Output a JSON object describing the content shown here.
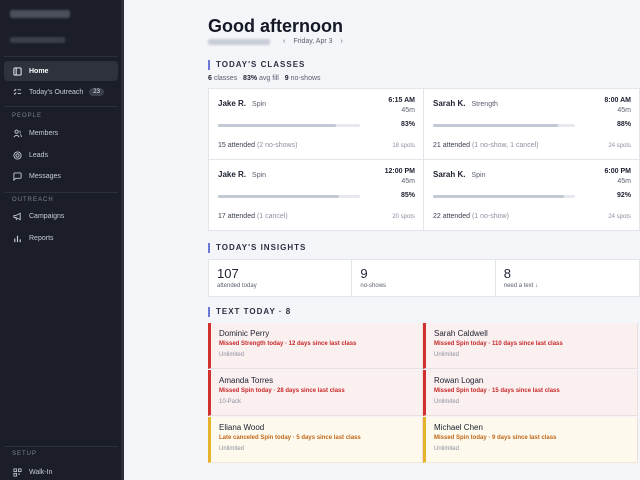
{
  "sidebar": {
    "nav": [
      {
        "label": "Home",
        "icon": "home-icon",
        "active": true
      },
      {
        "label": "Today's Outreach",
        "icon": "checklist-icon",
        "badge": "23"
      }
    ],
    "people_section": "PEOPLE",
    "people": [
      {
        "label": "Members",
        "icon": "users-icon"
      },
      {
        "label": "Leads",
        "icon": "target-icon"
      },
      {
        "label": "Messages",
        "icon": "chat-icon"
      }
    ],
    "outreach_section": "OUTREACH",
    "outreach": [
      {
        "label": "Campaigns",
        "icon": "megaphone-icon"
      },
      {
        "label": "Reports",
        "icon": "bar-chart-icon"
      }
    ],
    "setup_section": "SETUP",
    "setup": [
      {
        "label": "Walk-In",
        "icon": "qr-icon"
      }
    ]
  },
  "header": {
    "greeting": "Good afternoon",
    "date": "Friday, Apr 3",
    "prev": "‹",
    "next": "›"
  },
  "classes": {
    "title": "TODAY'S CLASSES",
    "summary": {
      "count": "6",
      "count_label": "classes",
      "fill": "83%",
      "fill_label": "avg fill",
      "noshows": "9",
      "noshows_label": "no-shows"
    },
    "items": [
      {
        "coach": "Jake R.",
        "type": "Spin",
        "time": "6:15 AM",
        "duration": "45m",
        "fill": 83,
        "pct": "83%",
        "attended": "15 attended",
        "note": "(2 no-shows)",
        "spots": "18 spots"
      },
      {
        "coach": "Sarah K.",
        "type": "Strength",
        "time": "8:00 AM",
        "duration": "45m",
        "fill": 88,
        "pct": "88%",
        "attended": "21 attended",
        "note": "(1 no-show, 1 cancel)",
        "spots": "24 spots"
      },
      {
        "coach": "Jake R.",
        "type": "Spin",
        "time": "12:00 PM",
        "duration": "45m",
        "fill": 85,
        "pct": "85%",
        "attended": "17 attended",
        "note": "(1 cancel)",
        "spots": "20 spots"
      },
      {
        "coach": "Sarah K.",
        "type": "Spin",
        "time": "6:00 PM",
        "duration": "45m",
        "fill": 92,
        "pct": "92%",
        "attended": "22 attended",
        "note": "(1 no-show)",
        "spots": "24 spots"
      }
    ]
  },
  "insights": {
    "title": "TODAY'S INSIGHTS",
    "items": [
      {
        "value": "107",
        "label": "attended today"
      },
      {
        "value": "9",
        "label": "no-shows"
      },
      {
        "value": "8",
        "label": "need a text ↓"
      }
    ]
  },
  "text_today": {
    "title": "TEXT TODAY · 8",
    "items": [
      {
        "name": "Dominic Perry",
        "message": "Missed Strength today · 12 days since last class",
        "plan": "Unlimited",
        "level": "alert"
      },
      {
        "name": "Sarah Caldwell",
        "message": "Missed Spin today · 110 days since last class",
        "plan": "Unlimited",
        "level": "alert"
      },
      {
        "name": "Amanda Torres",
        "message": "Missed Spin today · 28 days since last class",
        "plan": "10-Pack",
        "level": "alert"
      },
      {
        "name": "Rowan Logan",
        "message": "Missed Spin today · 15 days since last class",
        "plan": "Unlimited",
        "level": "alert"
      },
      {
        "name": "Eliana Wood",
        "message": "Late canceled Spin today · 5 days since last class",
        "plan": "Unlimited",
        "level": "warn"
      },
      {
        "name": "Michael Chen",
        "message": "Missed Spin today · 9 days since last class",
        "plan": "Unlimited",
        "level": "warn"
      }
    ]
  },
  "colors": {
    "accent": "#6c76d8",
    "alert": "#d22f2f",
    "warn": "#e5b22a",
    "sidebar": "#1b1e26"
  }
}
